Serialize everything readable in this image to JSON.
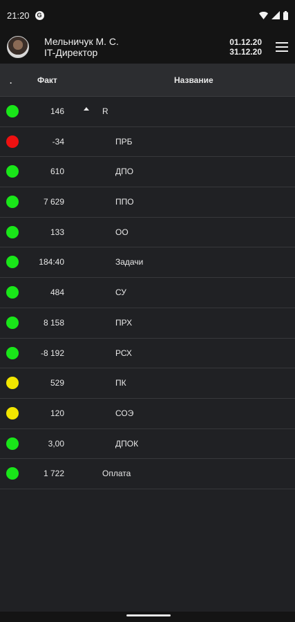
{
  "status_bar": {
    "time": "21:20",
    "app_icon": "G"
  },
  "header": {
    "user_name": "Мельничук М. С.",
    "user_role": "IT-Директор",
    "date_from": "01.12.20",
    "date_to": "31.12.20"
  },
  "table": {
    "col_status": ".",
    "col_fact": "Факт",
    "col_name": "Название",
    "rows": [
      {
        "status": "green",
        "fact": "146",
        "name": "R",
        "expanded": true
      },
      {
        "status": "red",
        "fact": "-34",
        "name": "ПРБ"
      },
      {
        "status": "green",
        "fact": "610",
        "name": "ДПО"
      },
      {
        "status": "green",
        "fact": "7 629",
        "name": "ППО"
      },
      {
        "status": "green",
        "fact": "133",
        "name": "ОО"
      },
      {
        "status": "green",
        "fact": "184:40",
        "name": "Задачи"
      },
      {
        "status": "green",
        "fact": "484",
        "name": "СУ"
      },
      {
        "status": "green",
        "fact": "8 158",
        "name": "ПРХ"
      },
      {
        "status": "green",
        "fact": "-8 192",
        "name": "РСХ"
      },
      {
        "status": "yellow",
        "fact": "529",
        "name": "ПК"
      },
      {
        "status": "yellow",
        "fact": "120",
        "name": "СОЭ"
      },
      {
        "status": "green",
        "fact": "3,00",
        "name": "ДПОК"
      },
      {
        "status": "green",
        "fact": "1 722",
        "name": "Оплата"
      }
    ]
  },
  "colors": {
    "green": "#19e619",
    "red": "#ee1111",
    "yellow": "#f2e600",
    "background": "#202124",
    "bar": "#141414"
  },
  "icons": {
    "status_bar_right": [
      "wifi-icon",
      "signal-icon",
      "battery-icon"
    ],
    "menu": "hamburger-menu-icon"
  }
}
